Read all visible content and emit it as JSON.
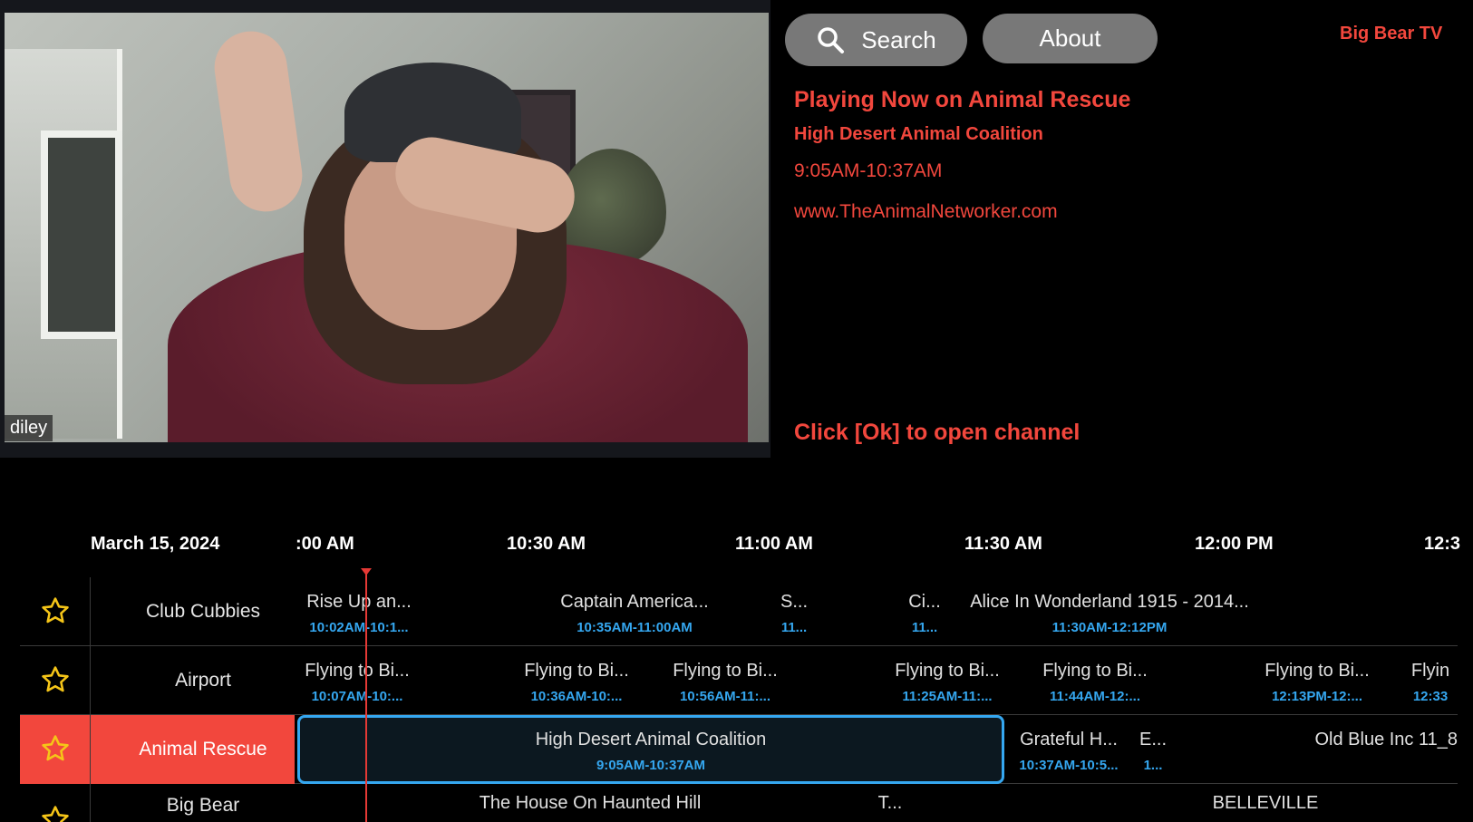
{
  "video": {
    "participant_name": "diley"
  },
  "header": {
    "search_label": "Search",
    "about_label": "About",
    "brand": "Big Bear TV"
  },
  "info": {
    "title": "Playing Now on Animal Rescue",
    "show": "High Desert Animal Coalition",
    "time": "9:05AM-10:37AM",
    "url": "www.TheAnimalNetworker.com",
    "hint": "Click [Ok] to open channel"
  },
  "guide": {
    "date": "March 15, 2024",
    "times": [
      ":00 AM",
      "10:30 AM",
      "11:00 AM",
      "11:30 AM",
      "12:00 PM",
      "12:3"
    ],
    "rows": [
      {
        "channel": "Club Cubbies",
        "programs": [
          {
            "title": "Rise Up an...",
            "time": "10:02AM-10:1..."
          },
          {
            "title": "Captain America...",
            "time": "10:35AM-11:00AM"
          },
          {
            "title": "S...",
            "time": "11..."
          },
          {
            "title": "Ci...",
            "time": "11..."
          },
          {
            "title": "Alice In Wonderland 1915 - 2014...",
            "time": "11:30AM-12:12PM"
          }
        ]
      },
      {
        "channel": "Airport",
        "programs": [
          {
            "title": "Flying to Bi...",
            "time": "10:07AM-10:..."
          },
          {
            "title": "Flying to Bi...",
            "time": "10:36AM-10:..."
          },
          {
            "title": "Flying to Bi...",
            "time": "10:56AM-11:..."
          },
          {
            "title": "Flying to Bi...",
            "time": "11:25AM-11:..."
          },
          {
            "title": "Flying to Bi...",
            "time": "11:44AM-12:..."
          },
          {
            "title": "Flying to Bi...",
            "time": "12:13PM-12:..."
          },
          {
            "title": "Flyin",
            "time": "12:33"
          }
        ]
      },
      {
        "channel": "Animal Rescue",
        "programs": [
          {
            "title": "High Desert Animal Coalition",
            "time": "9:05AM-10:37AM"
          },
          {
            "title": "Grateful H...",
            "time": "10:37AM-10:5..."
          },
          {
            "title": "E...",
            "time": "1..."
          },
          {
            "title": "Old Blue Inc 11_8",
            "time": ""
          }
        ]
      },
      {
        "channel": "Big Bear",
        "programs": [
          {
            "title": "The House On Haunted Hill",
            "time": ""
          },
          {
            "title": "T...",
            "time": ""
          },
          {
            "title": "BELLEVILLE",
            "time": ""
          }
        ]
      }
    ]
  },
  "colors": {
    "accent_red": "#f2473d",
    "time_blue": "#35a7f0",
    "button_gray": "#787878"
  }
}
